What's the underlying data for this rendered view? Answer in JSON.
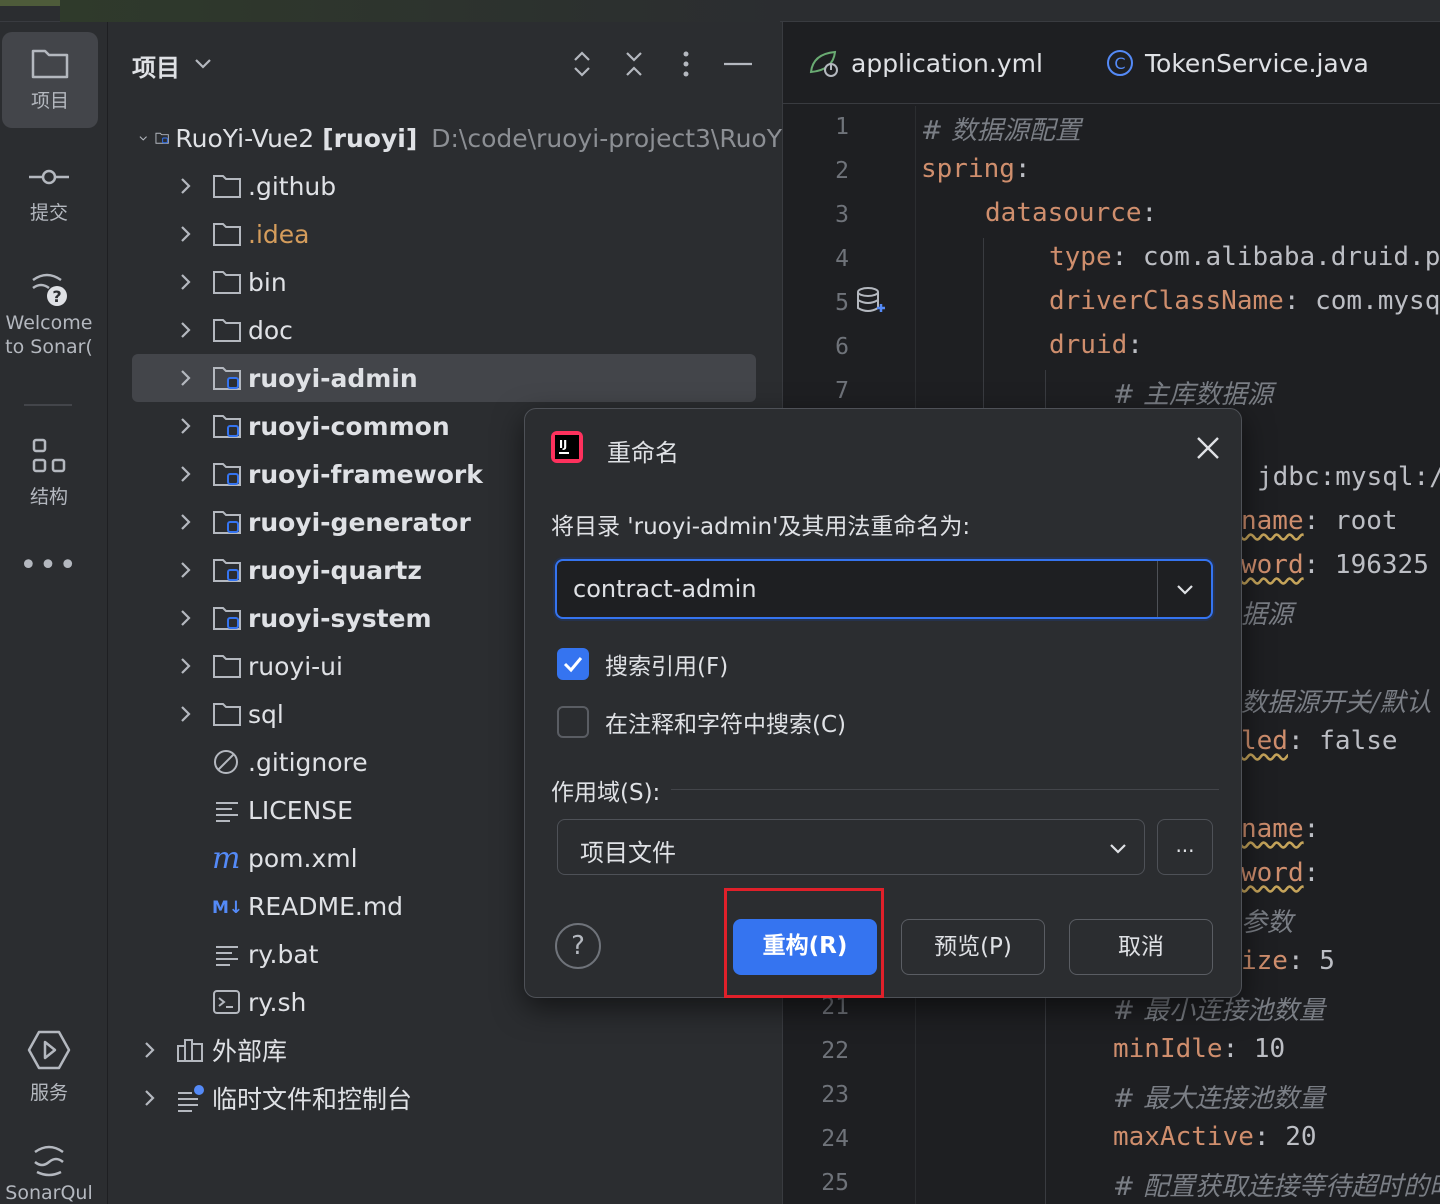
{
  "sidebar": {
    "items": [
      {
        "label": "项目",
        "icon": "folder-icon"
      },
      {
        "label": "提交",
        "icon": "commit-icon"
      },
      {
        "label": "Welcome",
        "label2": "to Sonar(",
        "icon": "sonar-help-icon"
      },
      {
        "label": "结构",
        "icon": "structure-icon"
      },
      {
        "label": "服务",
        "icon": "services-icon"
      },
      {
        "label": "SonarQul",
        "icon": "sonarqube-icon"
      }
    ]
  },
  "project_panel": {
    "title": "项目",
    "root": {
      "name": "RuoYi-Vue2",
      "module": "[ruoyi]",
      "path": "D:\\code\\ruoyi-project3\\RuoY"
    },
    "items": [
      {
        "name": ".github"
      },
      {
        "name": ".idea"
      },
      {
        "name": "bin"
      },
      {
        "name": "doc"
      },
      {
        "name": "ruoyi-admin"
      },
      {
        "name": "ruoyi-common"
      },
      {
        "name": "ruoyi-framework"
      },
      {
        "name": "ruoyi-generator"
      },
      {
        "name": "ruoyi-quartz"
      },
      {
        "name": "ruoyi-system"
      },
      {
        "name": "ruoyi-ui"
      },
      {
        "name": "sql"
      },
      {
        "name": ".gitignore"
      },
      {
        "name": "LICENSE"
      },
      {
        "name": "pom.xml"
      },
      {
        "name": "README.md"
      },
      {
        "name": "ry.bat"
      },
      {
        "name": "ry.sh"
      },
      {
        "name": "外部库"
      },
      {
        "name": "临时文件和控制台"
      }
    ]
  },
  "editor": {
    "tabs": [
      {
        "label": "application.yml"
      },
      {
        "label": "TokenService.java"
      }
    ],
    "lines": [
      {
        "n": "1",
        "comment": "#  数据源配置"
      },
      {
        "n": "2",
        "key": "spring",
        "colon": ":"
      },
      {
        "n": "3",
        "key": "datasource",
        "colon": ":"
      },
      {
        "n": "4",
        "key": "type",
        "colon": ":",
        "value": " com.alibaba.druid.p"
      },
      {
        "n": "5",
        "key": "driverClassName",
        "colon": ":",
        "value": " com.mysq"
      },
      {
        "n": "6",
        "key": "druid",
        "colon": ":"
      },
      {
        "n": "7",
        "comment": "#  主库数据源"
      },
      {
        "n": "",
        "value": "jdbc:mysql:/"
      },
      {
        "n": "",
        "key": "name",
        "colon": ":",
        "value": " root"
      },
      {
        "n": "",
        "key": "word",
        "colon": ":",
        "value": " 196325"
      },
      {
        "n": "",
        "comment": "据源"
      },
      {
        "n": "",
        "comment": "数据源开关/默认"
      },
      {
        "n": "",
        "key": "led",
        "colon": ":",
        "value": " false"
      },
      {
        "n": "",
        "key": "name",
        "colon": ":"
      },
      {
        "n": "",
        "key": "word",
        "colon": ":"
      },
      {
        "n": "",
        "comment": "参数"
      },
      {
        "n": "",
        "key": "ize",
        "colon": ":",
        "value": " 5"
      },
      {
        "n": "21",
        "comment": "#  最小连接池数量"
      },
      {
        "n": "22",
        "key": "minIdle",
        "colon": ":",
        "value": " 10"
      },
      {
        "n": "23",
        "comment": "#  最大连接池数量"
      },
      {
        "n": "24",
        "key": "maxActive",
        "colon": ":",
        "value": " 20"
      },
      {
        "n": "25",
        "comment": "#  配置获取连接等待超时的时"
      }
    ]
  },
  "dialog": {
    "title": "重命名",
    "prompt": "将目录 'ruoyi-admin'及其用法重命名为:",
    "new_name": "contract-admin",
    "search_references": {
      "label": "搜索引用(F)",
      "checked": true
    },
    "search_comments": {
      "label": "在注释和字符中搜索(C)",
      "checked": false
    },
    "scope_label": "作用域(S):",
    "scope_value": "项目文件",
    "more_label": "...",
    "help_label": "?",
    "buttons": {
      "refactor": "重构(R)",
      "preview": "预览(P)",
      "cancel": "取消"
    }
  },
  "colors": {
    "accent": "#3574f0",
    "highlight": "#e0202a",
    "yaml_key": "#cf8e6d",
    "comment": "#7a7e85"
  }
}
